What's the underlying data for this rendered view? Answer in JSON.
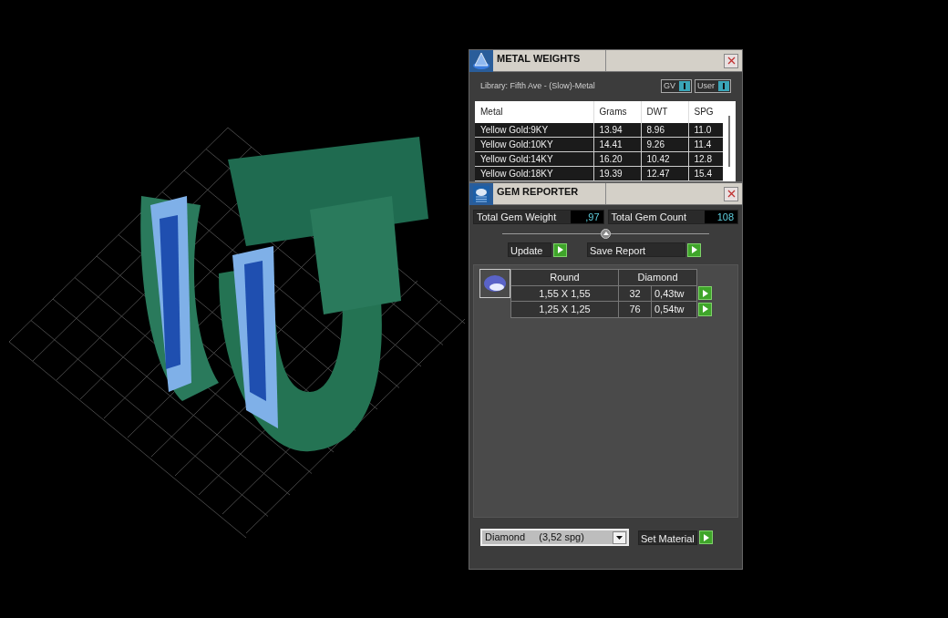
{
  "metal_weights": {
    "title": "METAL WEIGHTS",
    "library": "Library: Fifth Ave - (Slow)-Metal",
    "toggles": [
      {
        "label": "GV",
        "on": true
      },
      {
        "label": "User",
        "on": true
      }
    ],
    "columns": [
      "Metal",
      "Grams",
      "DWT",
      "SPG"
    ],
    "rows": [
      [
        "Yellow Gold:9KY",
        "13.94",
        "8.96",
        "11.0"
      ],
      [
        "Yellow Gold:10KY",
        "14.41",
        "9.26",
        "11.4"
      ],
      [
        "Yellow Gold:14KY",
        "16.20",
        "10.42",
        "12.8"
      ],
      [
        "Yellow Gold:18KY",
        "19.39",
        "12.47",
        "15.4"
      ]
    ]
  },
  "gem_reporter": {
    "title": "GEM REPORTER",
    "totals": [
      {
        "label": "Total Gem Weight",
        "value": ",97"
      },
      {
        "label": "Total Gem Count",
        "value": "108"
      }
    ],
    "buttons": [
      "Update",
      "Save Report"
    ],
    "gem_table": {
      "shape": "Round",
      "material": "Diamond",
      "rows": [
        {
          "size": "1,55 X 1,55",
          "count": "32",
          "weight": "0,43tw"
        },
        {
          "size": "1,25 X 1,25",
          "count": "76",
          "weight": "0,54tw"
        }
      ]
    },
    "material_select": {
      "value": "Diamond     (3,52 spg)"
    },
    "set_button": "Set Material"
  }
}
